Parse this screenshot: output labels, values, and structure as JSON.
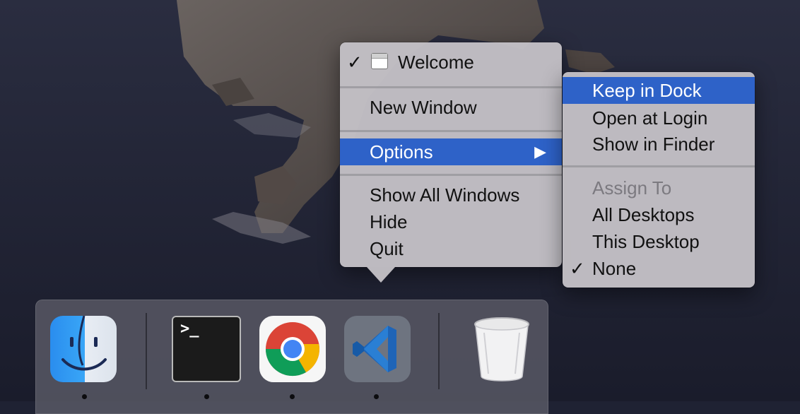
{
  "main_menu": {
    "items": [
      {
        "label": "Welcome",
        "checked": true
      },
      {
        "label": "New Window"
      },
      {
        "label": "Options",
        "highlighted": true,
        "has_submenu": true
      },
      {
        "label": "Show All Windows"
      },
      {
        "label": "Hide"
      },
      {
        "label": "Quit"
      }
    ],
    "check_glyph": "✓",
    "submenu_arrow": "▶"
  },
  "options_submenu": {
    "items": [
      {
        "label": "Keep in Dock",
        "highlighted": true
      },
      {
        "label": "Open at Login"
      },
      {
        "label": "Show in Finder"
      }
    ],
    "assign_header": "Assign To",
    "assign_items": [
      {
        "label": "All Desktops"
      },
      {
        "label": "This Desktop"
      },
      {
        "label": "None",
        "checked": true
      }
    ]
  },
  "dock": {
    "apps": [
      {
        "name": "Finder",
        "icon": "finder-icon",
        "running": true
      },
      {
        "name": "Terminal",
        "icon": "terminal-icon",
        "running": true,
        "prompt": ">_"
      },
      {
        "name": "Google Chrome",
        "icon": "chrome-icon",
        "running": true
      },
      {
        "name": "Visual Studio Code",
        "icon": "vscode-icon",
        "running": true
      },
      {
        "name": "Trash",
        "icon": "trash-icon",
        "running": false
      }
    ]
  },
  "colors": {
    "menu_highlight": "#2e62c8",
    "menu_background": "#c4c1c6",
    "disabled_text": "#7c7a80"
  }
}
